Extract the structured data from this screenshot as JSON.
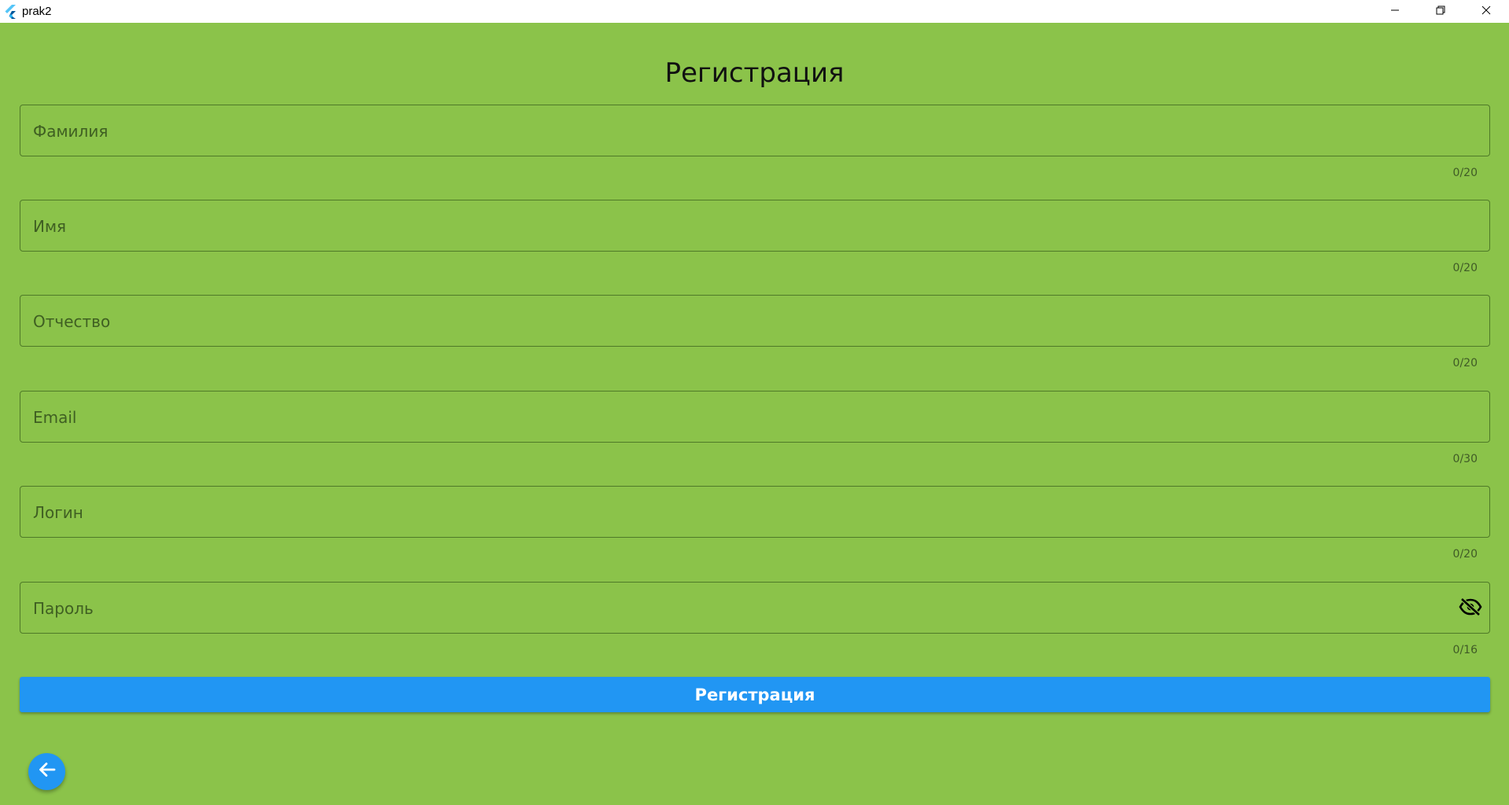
{
  "window": {
    "title": "prak2",
    "icons": {
      "app": "flutter-logo-icon",
      "minimize": "minimize-icon",
      "restore": "restore-icon",
      "close": "close-icon"
    }
  },
  "page": {
    "title": "Регистрация",
    "background": "#8BC34A"
  },
  "form": {
    "fields": [
      {
        "placeholder": "Фамилия",
        "value": "",
        "counter": "0/20"
      },
      {
        "placeholder": "Имя",
        "value": "",
        "counter": "0/20"
      },
      {
        "placeholder": "Отчество",
        "value": "",
        "counter": "0/20"
      },
      {
        "placeholder": "Email",
        "value": "",
        "counter": "0/30"
      },
      {
        "placeholder": "Логин",
        "value": "",
        "counter": "0/20"
      },
      {
        "placeholder": "Пароль",
        "value": "",
        "counter": "0/16",
        "trailing_icon": "visibility-off-icon"
      }
    ],
    "submit_label": "Регистрация",
    "submit_color": "#2196F3"
  },
  "fab": {
    "icon": "arrow-back-icon",
    "color": "#2196F3"
  }
}
